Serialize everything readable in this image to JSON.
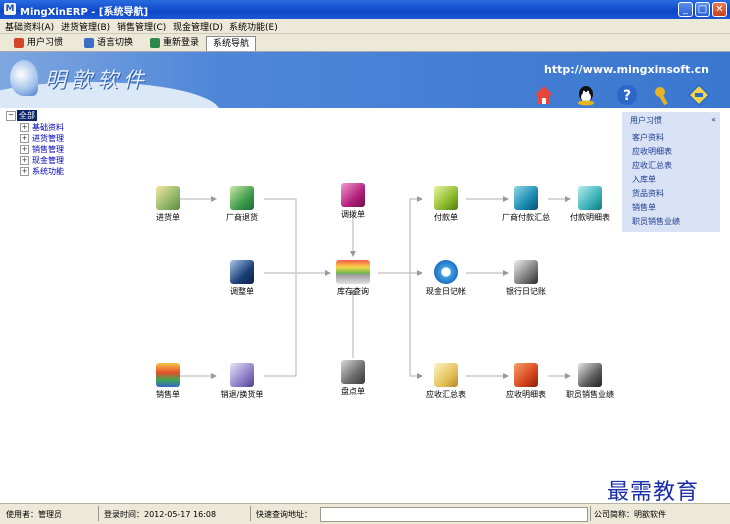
{
  "window": {
    "title": "MingXinERP - [系统导航]"
  },
  "menu": [
    "基础资料(A)",
    "进货管理(B)",
    "销售管理(C)",
    "现金管理(D)",
    "系统功能(E)"
  ],
  "tabs": [
    "用户习惯",
    "语言切换",
    "重新登录",
    "系统导航"
  ],
  "banner": {
    "brand": "明歆软件",
    "url": "http://www.mingxinsoft.cn"
  },
  "tree": {
    "root": "全部",
    "items": [
      "基础资料",
      "进货管理",
      "销售管理",
      "现金管理",
      "系统功能"
    ]
  },
  "nav": {
    "purchase": "进货单",
    "vendor_return": "厂商退货",
    "adjust": "调整单",
    "sales": "销售单",
    "sales_return": "销退/换货单",
    "transfer": "调拨单",
    "inventory": "库存查询",
    "stocktake": "盘点单",
    "payment": "付款单",
    "vendor_payment_summary": "厂商付款汇总",
    "payment_detail": "付款明细表",
    "cash_journal": "现金日记帐",
    "bank_journal": "银行日记账",
    "receivable_summary": "应收汇总表",
    "receivable_detail": "应收明细表",
    "staff_sales": "职员销售业绩"
  },
  "right_panel": {
    "title": "用户习惯",
    "items": [
      "客户资料",
      "应收明细表",
      "应收汇总表",
      "入库单",
      "货品资料",
      "销售单",
      "职员销售业绩"
    ]
  },
  "status": {
    "user_label": "使用者：管理员",
    "login_label": "登录时间：2012-05-17 16:08",
    "query_label": "快速查询地址：",
    "company_label": "公司简称：明歆软件"
  },
  "watermark": "最需教育"
}
